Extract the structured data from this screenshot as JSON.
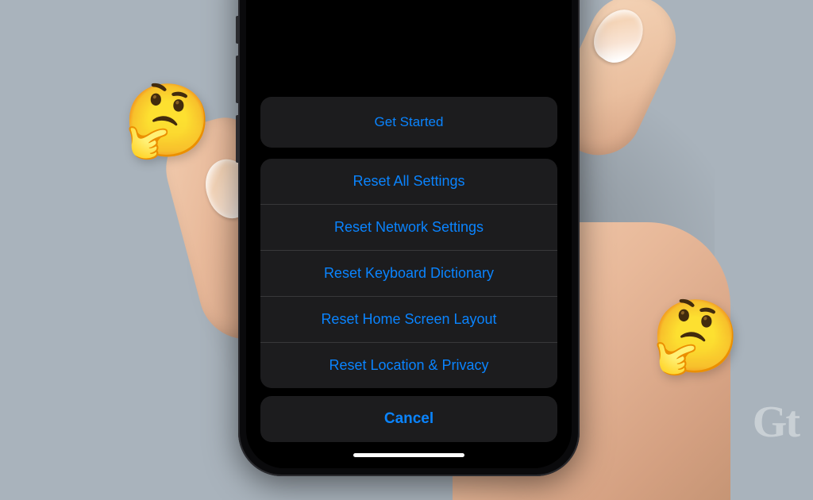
{
  "top": {
    "get_started": "Get Started"
  },
  "reset_menu": {
    "items": [
      "Reset All Settings",
      "Reset Network Settings",
      "Reset Keyboard Dictionary",
      "Reset Home Screen Layout",
      "Reset Location & Privacy"
    ],
    "cancel": "Cancel"
  },
  "decorations": {
    "emoji_left": "🤔",
    "emoji_right": "🤔",
    "logo": "Gt"
  }
}
